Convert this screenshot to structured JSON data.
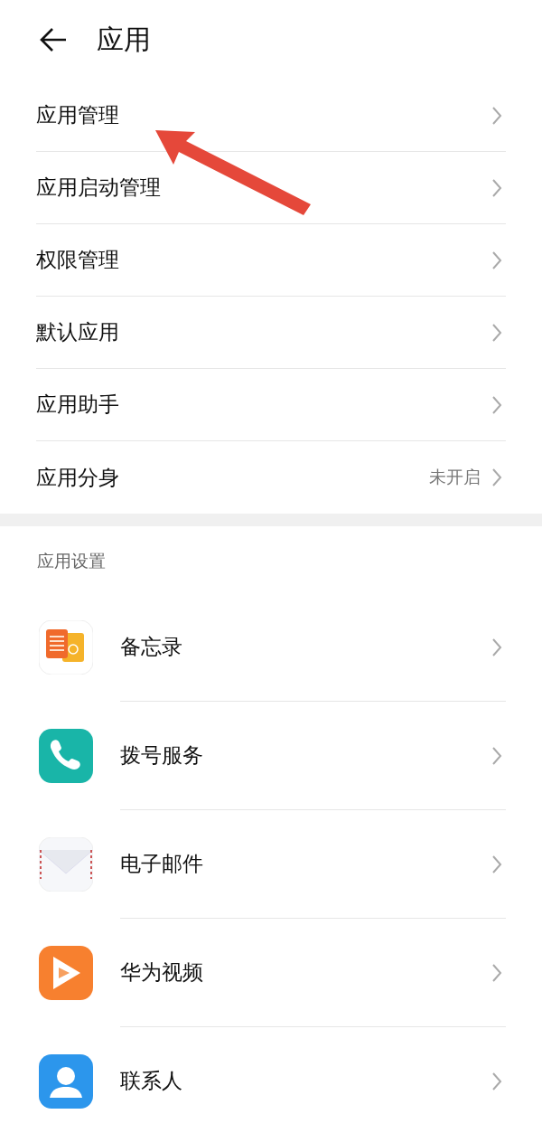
{
  "header": {
    "title": "应用"
  },
  "menu": [
    {
      "label": "应用管理"
    },
    {
      "label": "应用启动管理"
    },
    {
      "label": "权限管理"
    },
    {
      "label": "默认应用"
    },
    {
      "label": "应用助手"
    },
    {
      "label": "应用分身",
      "value": "未开启"
    }
  ],
  "app_settings": {
    "heading": "应用设置",
    "apps": [
      {
        "name": "备忘录",
        "kind": "notes"
      },
      {
        "name": "拨号服务",
        "kind": "phone"
      },
      {
        "name": "电子邮件",
        "kind": "mail"
      },
      {
        "name": "华为视频",
        "kind": "video"
      },
      {
        "name": "联系人",
        "kind": "contacts"
      }
    ]
  }
}
